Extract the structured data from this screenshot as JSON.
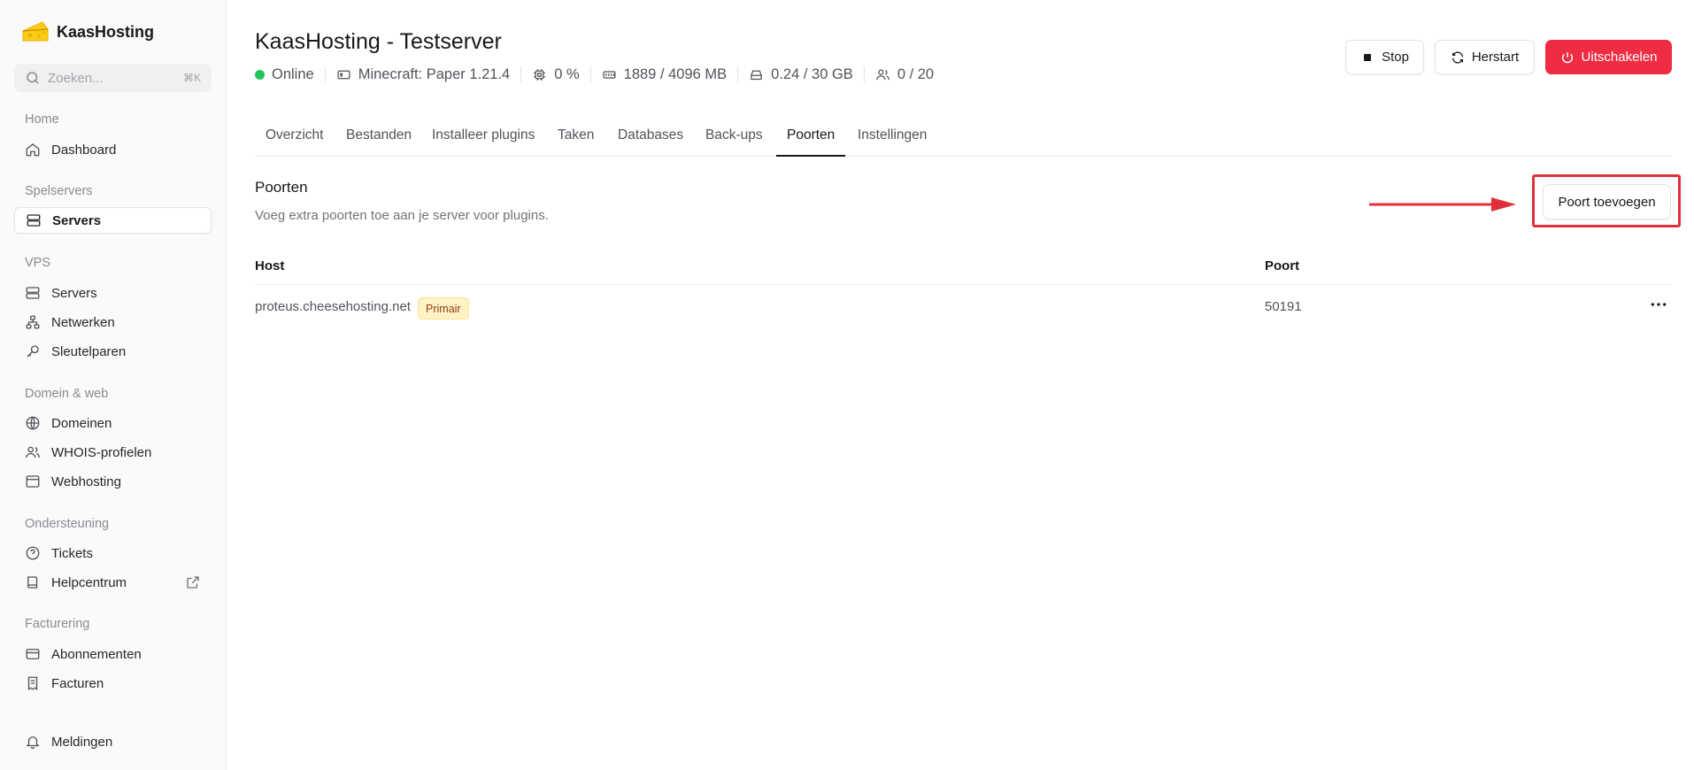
{
  "brand": {
    "name": "KaasHosting"
  },
  "search": {
    "placeholder": "Zoeken...",
    "shortcut": "⌘K"
  },
  "sidebar": {
    "groups": [
      {
        "label": "Home",
        "items": [
          {
            "label": "Dashboard",
            "icon": "home-icon"
          }
        ]
      },
      {
        "label": "Spelservers",
        "items": [
          {
            "label": "Servers",
            "icon": "server-icon",
            "active": true
          }
        ]
      },
      {
        "label": "VPS",
        "items": [
          {
            "label": "Servers",
            "icon": "server-icon"
          },
          {
            "label": "Netwerken",
            "icon": "network-icon"
          },
          {
            "label": "Sleutelparen",
            "icon": "key-icon"
          }
        ]
      },
      {
        "label": "Domein & web",
        "items": [
          {
            "label": "Domeinen",
            "icon": "globe-icon"
          },
          {
            "label": "WHOIS-profielen",
            "icon": "users-icon"
          },
          {
            "label": "Webhosting",
            "icon": "browser-window-icon"
          }
        ]
      },
      {
        "label": "Ondersteuning",
        "items": [
          {
            "label": "Tickets",
            "icon": "help-circle-icon"
          },
          {
            "label": "Helpcentrum",
            "icon": "book-icon",
            "external": true
          }
        ]
      },
      {
        "label": "Facturering",
        "items": [
          {
            "label": "Abonnementen",
            "icon": "credit-card-icon"
          },
          {
            "label": "Facturen",
            "icon": "receipt-icon"
          }
        ]
      }
    ],
    "footer": {
      "label": "Meldingen",
      "icon": "bell-icon"
    }
  },
  "server": {
    "title": "KaasHosting - Testserver",
    "status": "Online",
    "software": "Minecraft: Paper 1.21.4",
    "cpu": "0 %",
    "memory": "1889 / 4096 MB",
    "disk": "0.24 / 30 GB",
    "players": "0 / 20"
  },
  "actions": {
    "stop": "Stop",
    "restart": "Herstart",
    "shutdown": "Uitschakelen"
  },
  "tabs": [
    "Overzicht",
    "Bestanden",
    "Installeer plugins",
    "Taken",
    "Databases",
    "Back-ups",
    "Poorten",
    "Instellingen"
  ],
  "active_tab": "Poorten",
  "ports": {
    "title": "Poorten",
    "description": "Voeg extra poorten toe aan je server voor plugins.",
    "add_label": "Poort toevoegen",
    "columns": [
      "Host",
      "Poort"
    ],
    "rows": [
      {
        "host": "proteus.cheesehosting.net",
        "badge": "Primair",
        "port": "50191"
      }
    ]
  },
  "colors": {
    "accent_danger": "#ef2c42",
    "online": "#22c55e",
    "highlight": "#e0303a",
    "badge_bg": "#fef3c7"
  }
}
